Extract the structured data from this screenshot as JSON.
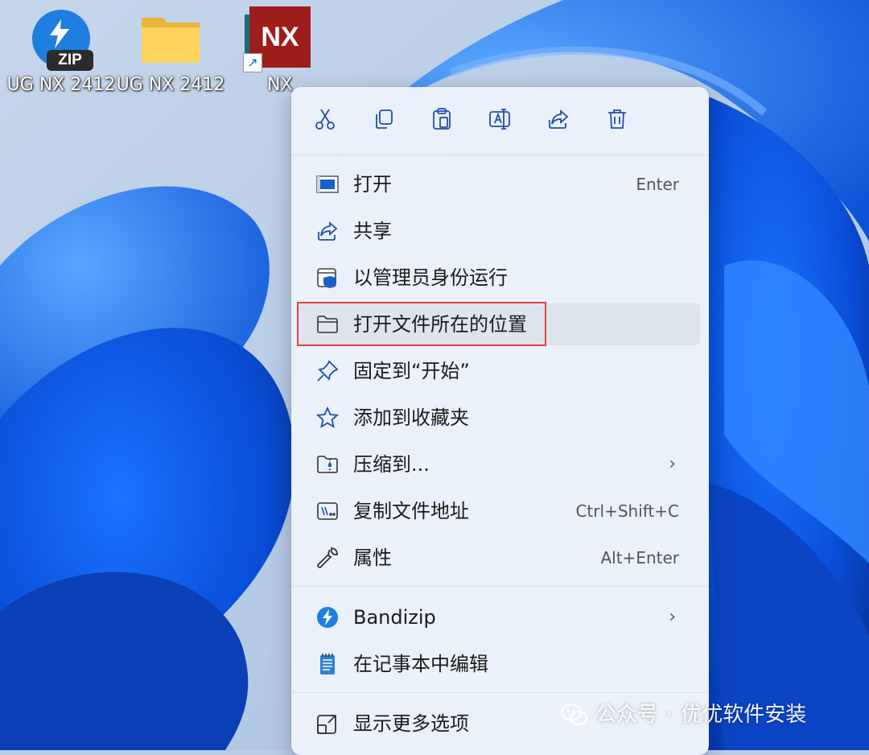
{
  "desktop": {
    "icons": [
      {
        "label": "UG NX 2412",
        "icon": "bandizip-zip-icon"
      },
      {
        "label": "UG NX 2412",
        "icon": "folder-icon"
      },
      {
        "label": "NX",
        "icon": "nx-shortcut-icon"
      }
    ]
  },
  "context_menu": {
    "toolbar": [
      {
        "name": "cut",
        "icon": "scissors-icon"
      },
      {
        "name": "copy",
        "icon": "copy-icon"
      },
      {
        "name": "paste",
        "icon": "clipboard-icon"
      },
      {
        "name": "rename",
        "icon": "rename-icon"
      },
      {
        "name": "share",
        "icon": "share-icon"
      },
      {
        "name": "delete",
        "icon": "trash-icon"
      }
    ],
    "items": [
      {
        "label": "打开",
        "shortcut": "Enter",
        "icon": "app-window-icon"
      },
      {
        "label": "共享",
        "shortcut": "",
        "icon": "share-icon"
      },
      {
        "label": "以管理员身份运行",
        "shortcut": "",
        "icon": "admin-shield-icon"
      },
      {
        "label": "打开文件所在的位置",
        "shortcut": "",
        "icon": "folder-open-icon",
        "highlighted": true
      },
      {
        "label": "固定到“开始”",
        "shortcut": "",
        "icon": "pin-icon"
      },
      {
        "label": "添加到收藏夹",
        "shortcut": "",
        "icon": "star-icon"
      },
      {
        "label": "压缩到...",
        "shortcut": "",
        "icon": "zip-folder-icon",
        "submenu": true
      },
      {
        "label": "复制文件地址",
        "shortcut": "Ctrl+Shift+C",
        "icon": "copy-path-icon"
      },
      {
        "label": "属性",
        "shortcut": "Alt+Enter",
        "icon": "wrench-icon"
      },
      {
        "label": "Bandizip",
        "shortcut": "",
        "icon": "bandizip-icon",
        "submenu": true
      },
      {
        "label": "在记事本中编辑",
        "shortcut": "",
        "icon": "notepad-icon"
      },
      {
        "label": "显示更多选项",
        "shortcut": "",
        "icon": "more-options-icon"
      }
    ],
    "submenu_chevron": "›"
  },
  "watermark": {
    "text": "公众号",
    "dot": "·",
    "account": "优优软件安装"
  },
  "colors": {
    "accent": "#1e7fe0",
    "highlight_border": "#e0433f",
    "nx_red": "#9d1d1a"
  }
}
